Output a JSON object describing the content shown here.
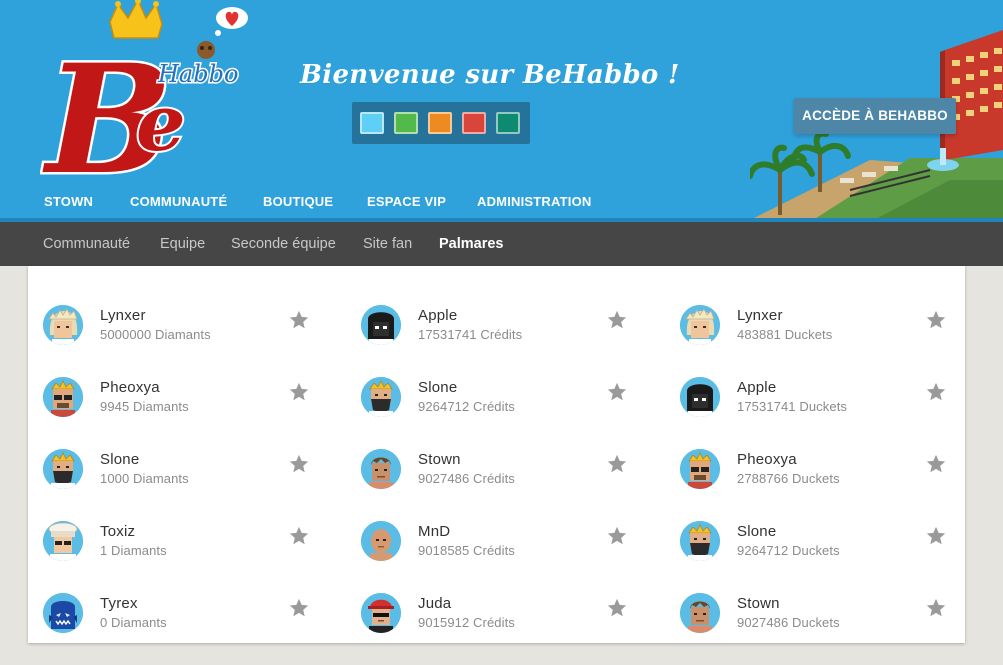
{
  "header": {
    "logo_text_big": "Be",
    "logo_text_small": "Habbo",
    "welcome": "Bienvenue sur BeHabbo !",
    "access_button": "ACCÈDE À BEHABBO",
    "theme_colors": [
      "#5fcff5",
      "#53b94a",
      "#ed8a21",
      "#d8453b",
      "#0e8a72"
    ]
  },
  "main_nav": [
    {
      "label": "STOWN"
    },
    {
      "label": "COMMUNAUTÉ"
    },
    {
      "label": "BOUTIQUE"
    },
    {
      "label": "ESPACE VIP"
    },
    {
      "label": "ADMINISTRATION"
    }
  ],
  "sub_nav": [
    {
      "label": "Communauté"
    },
    {
      "label": "Equipe"
    },
    {
      "label": "Seconde équipe"
    },
    {
      "label": "Site fan"
    },
    {
      "label": "Palmares",
      "active": true
    }
  ],
  "columns": [
    {
      "entries": [
        {
          "name": "Lynxer",
          "score": "5000000 Diamants",
          "avatar": "blonde-spiky"
        },
        {
          "name": "Pheoxya",
          "score": "9945 Diamants",
          "avatar": "crown-glasses"
        },
        {
          "name": "Slone",
          "score": "1000 Diamants",
          "avatar": "crown-beard"
        },
        {
          "name": "Toxiz",
          "score": "1 Diamants",
          "avatar": "chef-hat"
        },
        {
          "name": "Tyrex",
          "score": "0 Diamants",
          "avatar": "blue-monster"
        }
      ]
    },
    {
      "entries": [
        {
          "name": "Apple",
          "score": "17531741 Crédits",
          "avatar": "black-hood"
        },
        {
          "name": "Slone",
          "score": "9264712 Crédits",
          "avatar": "crown-beard"
        },
        {
          "name": "Stown",
          "score": "9027486 Crédits",
          "avatar": "brown-hair"
        },
        {
          "name": "MnD",
          "score": "9018585 Crédits",
          "avatar": "bald"
        },
        {
          "name": "Juda",
          "score": "9015912 Crédits",
          "avatar": "red-cap"
        }
      ]
    },
    {
      "entries": [
        {
          "name": "Lynxer",
          "score": "483881 Duckets",
          "avatar": "blonde-spiky"
        },
        {
          "name": "Apple",
          "score": "17531741 Duckets",
          "avatar": "black-hood"
        },
        {
          "name": "Pheoxya",
          "score": "2788766 Duckets",
          "avatar": "crown-glasses"
        },
        {
          "name": "Slone",
          "score": "9264712 Duckets",
          "avatar": "crown-beard"
        },
        {
          "name": "Stown",
          "score": "9027486 Duckets",
          "avatar": "brown-hair"
        }
      ]
    }
  ]
}
